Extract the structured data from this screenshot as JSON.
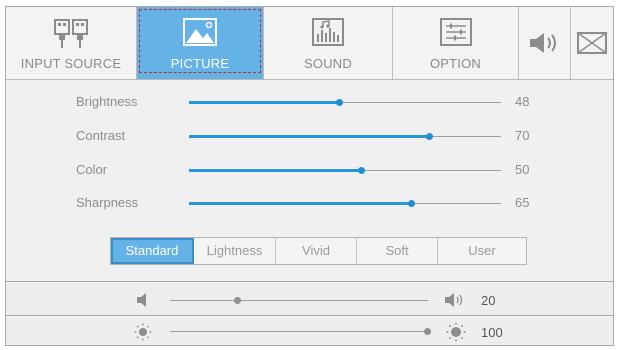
{
  "tabs": [
    {
      "label": "INPUT SOURCE",
      "icon": "input-source-icon"
    },
    {
      "label": "PICTURE",
      "icon": "picture-icon",
      "active": true
    },
    {
      "label": "SOUND",
      "icon": "sound-icon"
    },
    {
      "label": "OPTION",
      "icon": "option-icon"
    }
  ],
  "extra_tabs": [
    {
      "icon": "volume-icon"
    },
    {
      "icon": "mail-icon"
    }
  ],
  "picture": {
    "brightness": {
      "label": "Brightness",
      "value": "48"
    },
    "contrast": {
      "label": "Contrast",
      "value": "70"
    },
    "color": {
      "label": "Color",
      "value": "50"
    },
    "sharpness": {
      "label": "Sharpness",
      "value": "65"
    }
  },
  "modes": {
    "options": [
      "Standard",
      "Lightness",
      "Vivid",
      "Soft",
      "User"
    ],
    "selected": "Standard"
  },
  "quick": {
    "volume": {
      "value": "20",
      "icon_low": "speaker-low-icon",
      "icon_high": "speaker-high-icon"
    },
    "backlight": {
      "value": "100",
      "icon_low": "brightness-low-icon",
      "icon_high": "brightness-high-icon"
    }
  },
  "colors": {
    "accent": "#1e8fd4",
    "active_tab": "#64b2e6",
    "highlight_border": "#c62828"
  }
}
